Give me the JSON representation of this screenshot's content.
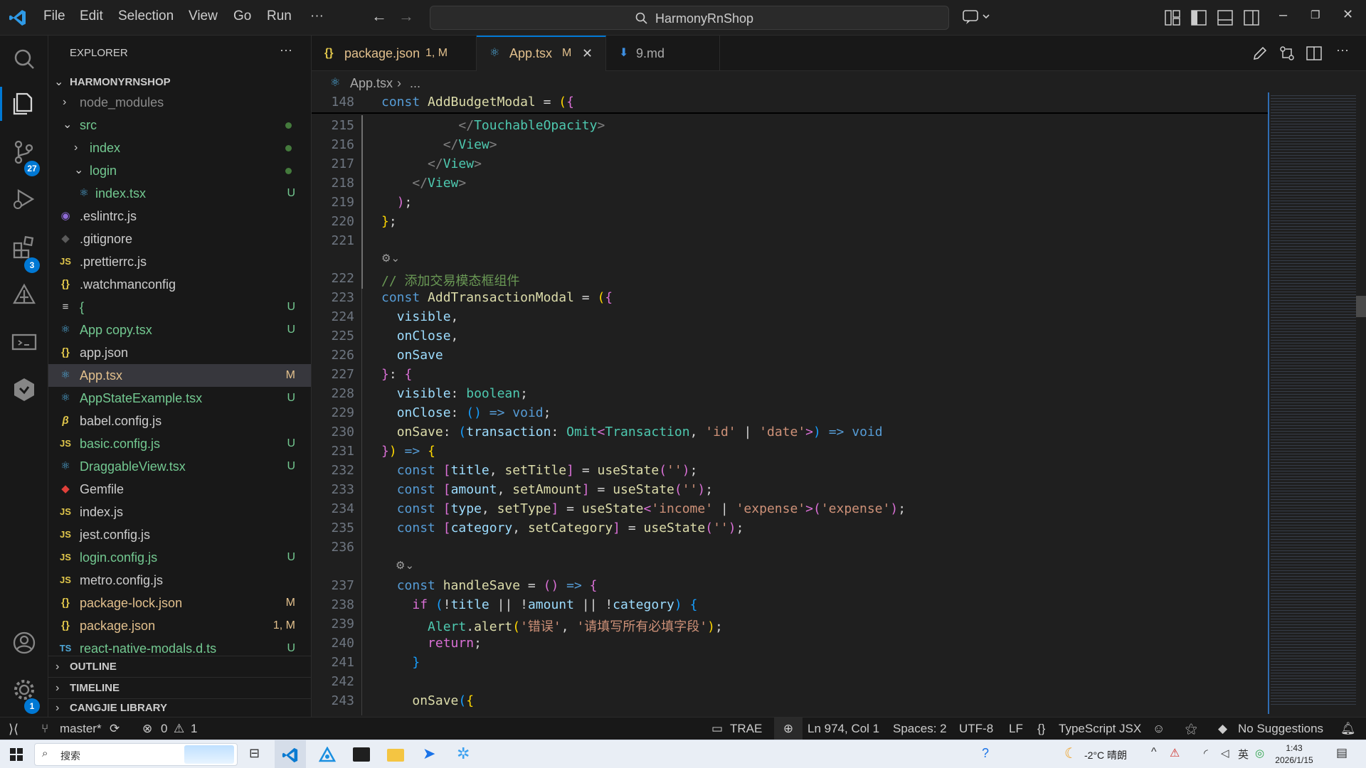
{
  "title_bar": {
    "menu": [
      "File",
      "Edit",
      "Selection",
      "View",
      "Go",
      "Run",
      "···"
    ],
    "search_text": "HarmonyRnShop"
  },
  "activity_bar": {
    "source_control_badge": "27",
    "extensions_badge": "3",
    "settings_badge": "1"
  },
  "sidebar": {
    "header": "EXPLORER",
    "more": "···",
    "root": "HARMONYRNSHOP",
    "items": [
      {
        "label": "node_modules",
        "status": ""
      },
      {
        "label": "src",
        "status": ""
      },
      {
        "label": "index",
        "status": ""
      },
      {
        "label": "login",
        "status": ""
      },
      {
        "label": "index.tsx",
        "status": "U"
      },
      {
        "label": ".eslintrc.js",
        "status": ""
      },
      {
        "label": ".gitignore",
        "status": ""
      },
      {
        "label": ".prettierrc.js",
        "status": ""
      },
      {
        "label": ".watchmanconfig",
        "status": ""
      },
      {
        "label": "{",
        "status": "U"
      },
      {
        "label": "App copy.tsx",
        "status": "U"
      },
      {
        "label": "app.json",
        "status": ""
      },
      {
        "label": "App.tsx",
        "status": "M"
      },
      {
        "label": "AppStateExample.tsx",
        "status": "U"
      },
      {
        "label": "babel.config.js",
        "status": ""
      },
      {
        "label": "basic.config.js",
        "status": "U"
      },
      {
        "label": "DraggableView.tsx",
        "status": "U"
      },
      {
        "label": "Gemfile",
        "status": ""
      },
      {
        "label": "index.js",
        "status": ""
      },
      {
        "label": "jest.config.js",
        "status": ""
      },
      {
        "label": "login.config.js",
        "status": "U"
      },
      {
        "label": "metro.config.js",
        "status": ""
      },
      {
        "label": "package-lock.json",
        "status": "M"
      },
      {
        "label": "package.json",
        "status": "1, M"
      },
      {
        "label": "react-native-modals.d.ts",
        "status": "U"
      }
    ],
    "sections": [
      "OUTLINE",
      "TIMELINE",
      "CANGJIE LIBRARY"
    ]
  },
  "tabs": [
    {
      "label": "package.json",
      "status": "1, M"
    },
    {
      "label": "App.tsx",
      "status": "M"
    },
    {
      "label": "9.md",
      "status": ""
    }
  ],
  "breadcrumb": {
    "file": "App.tsx",
    "rest": "..."
  },
  "editor": {
    "sticky_line_no": "148",
    "sticky_code": "const AddBudgetModal = ({",
    "line_numbers": [
      "215",
      "216",
      "217",
      "218",
      "219",
      "220",
      "221",
      "222",
      "223",
      "224",
      "225",
      "226",
      "227",
      "228",
      "229",
      "230",
      "231",
      "232",
      "233",
      "234",
      "235",
      "236",
      "237",
      "238",
      "239",
      "240",
      "241",
      "242",
      "243"
    ],
    "comment_text": "// 添加交易模态框组件",
    "alert_title": "'错误'",
    "alert_message": "'请填写所有必填字段'"
  },
  "status_bar": {
    "branch": "master*",
    "errors": "0",
    "warnings": "1",
    "trae": "TRAE",
    "position": "Ln 974, Col 1",
    "spaces": "Spaces: 2",
    "encoding": "UTF-8",
    "eol": "LF",
    "language": "TypeScript JSX",
    "suggestions": "No Suggestions"
  },
  "taskbar": {
    "search": "搜索",
    "weather": "-2°C 晴朗",
    "time": "1:43",
    "date": "2026/1/15"
  },
  "colors": {
    "accent": "#0078d4",
    "untracked": "#73c991",
    "modified": "#e2c08d"
  }
}
